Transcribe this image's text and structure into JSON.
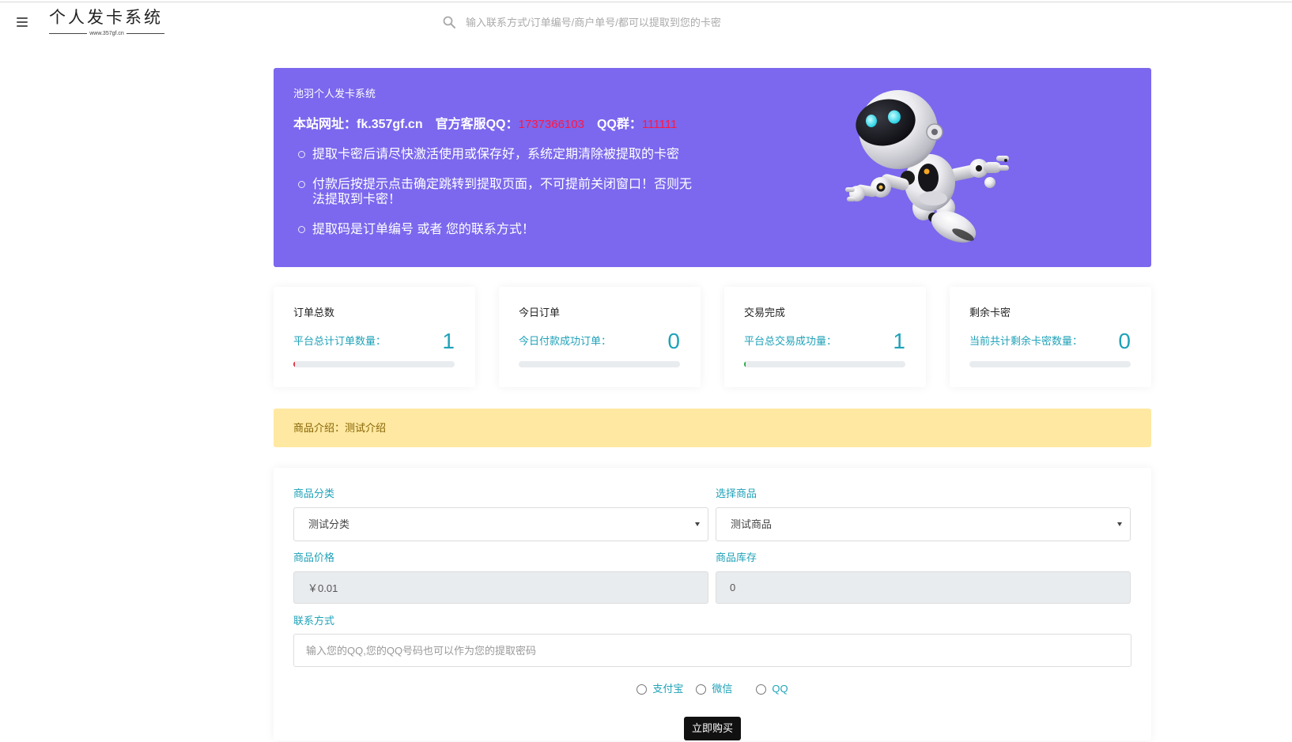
{
  "header": {
    "logo_text": "个人发卡系统",
    "logo_subtitle": "www.357gf.cn",
    "search_placeholder": "输入联系方式/订单编号/商户单号/都可以提取到您的卡密",
    "menu_icon": "hamburger-icon",
    "search_icon": "search-icon"
  },
  "banner": {
    "title": "池羽个人发卡系统",
    "site_label": "本站网址：",
    "site_url": "fk.357gf.cn",
    "support_qq_label": "官方客服QQ：",
    "support_qq": "1737366103",
    "qq_group_label": "QQ群：",
    "qq_group": "111111",
    "notices": [
      "提取卡密后请尽快激活使用或保存好，系统定期清除被提取的卡密",
      "付款后按提示点击确定跳转到提取页面，不可提前关闭窗口！否则无法提取到卡密！",
      "提取码是订单编号 或者 您的联系方式！"
    ],
    "illustration": "robot-illustration"
  },
  "stats": [
    {
      "title": "订单总数",
      "label": "平台总计订单数量：",
      "value": "1",
      "progress_percent": 1,
      "bar_color": "#DC3545"
    },
    {
      "title": "今日订单",
      "label": "今日付款成功订单：",
      "value": "0",
      "progress_percent": 0,
      "bar_color": "#1FA2B8"
    },
    {
      "title": "交易完成",
      "label": "平台总交易成功量：",
      "value": "1",
      "progress_percent": 1,
      "bar_color": "#28A745"
    },
    {
      "title": "剩余卡密",
      "label": "当前共计剩余卡密数量：",
      "value": "0",
      "progress_percent": 0,
      "bar_color": "#1FA2B8"
    }
  ],
  "product_intro": {
    "text": "商品介绍：测试介绍"
  },
  "order_form": {
    "category_label": "商品分类",
    "category_value": "测试分类",
    "product_label": "选择商品",
    "product_value": "测试商品",
    "price_label": "商品价格",
    "price_value": "￥0.01",
    "stock_label": "商品库存",
    "stock_value": "0",
    "contact_label": "联系方式",
    "contact_placeholder": "输入您的QQ,您的QQ号码也可以作为您的提取密码",
    "payment_options": [
      "支付宝",
      "微信",
      "QQ"
    ],
    "submit_label": "立即购买",
    "select_icon": "caret-down-icon"
  },
  "theme": {
    "banner_bg": "#7B68EE",
    "highlight": "#FF1744",
    "teal": "#1FA2B8",
    "alert_bg": "#FFE8A1",
    "alert_text": "#856404",
    "button_bg": "#111111"
  }
}
